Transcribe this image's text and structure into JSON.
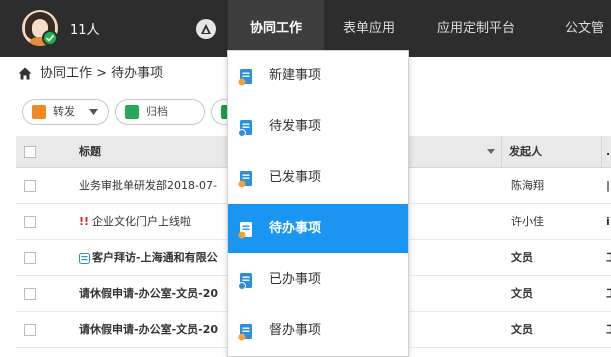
{
  "header": {
    "user_count": "11人",
    "nav": [
      {
        "label": "协同工作",
        "active": true
      },
      {
        "label": "表单应用",
        "active": false
      },
      {
        "label": "应用定制平台",
        "active": false
      },
      {
        "label": "公文管",
        "active": false
      }
    ],
    "icons": [
      "avatar",
      "online-check-icon",
      "platform-logo-icon"
    ]
  },
  "breadcrumb": {
    "text": "协同工作 > 待办事项",
    "icon": "home-icon"
  },
  "toolbar": {
    "forward_label": "转发",
    "archive_label": "归档",
    "delete_icon": "trash-icon"
  },
  "table": {
    "columns": [
      "标题",
      "发起人"
    ],
    "rows": [
      {
        "title": "业务审批单研发部2018-07-",
        "initiator": "陈海翔",
        "extra": "",
        "bold": false
      },
      {
        "title": "企业文化门户上线啦",
        "urgent_mark": "!!",
        "initiator": "许小佳",
        "extra": "",
        "bold": false
      },
      {
        "title": "客户拜访-上海通和有限公",
        "initiator": "文员",
        "extra": "",
        "bold": true
      },
      {
        "title": "请休假申请-办公室-文员-20",
        "initiator": "文员",
        "extra": "",
        "bold": true
      },
      {
        "title": "请休假申请-办公室-文员-20",
        "initiator": "文员",
        "extra": "",
        "bold": true
      }
    ]
  },
  "dropdown": {
    "items": [
      {
        "label": "新建事项",
        "active": false
      },
      {
        "label": "待发事项",
        "active": false
      },
      {
        "label": "已发事项",
        "active": false
      },
      {
        "label": "待办事项",
        "active": true
      },
      {
        "label": "已办事项",
        "active": false
      },
      {
        "label": "督办事项",
        "active": false
      }
    ]
  },
  "colors": {
    "topbar": "#2d2d2d",
    "menu_active": "#1a96f2",
    "urgent": "#e02020",
    "forward_icon": "#f08a24",
    "archive_icon": "#2aa75a"
  }
}
